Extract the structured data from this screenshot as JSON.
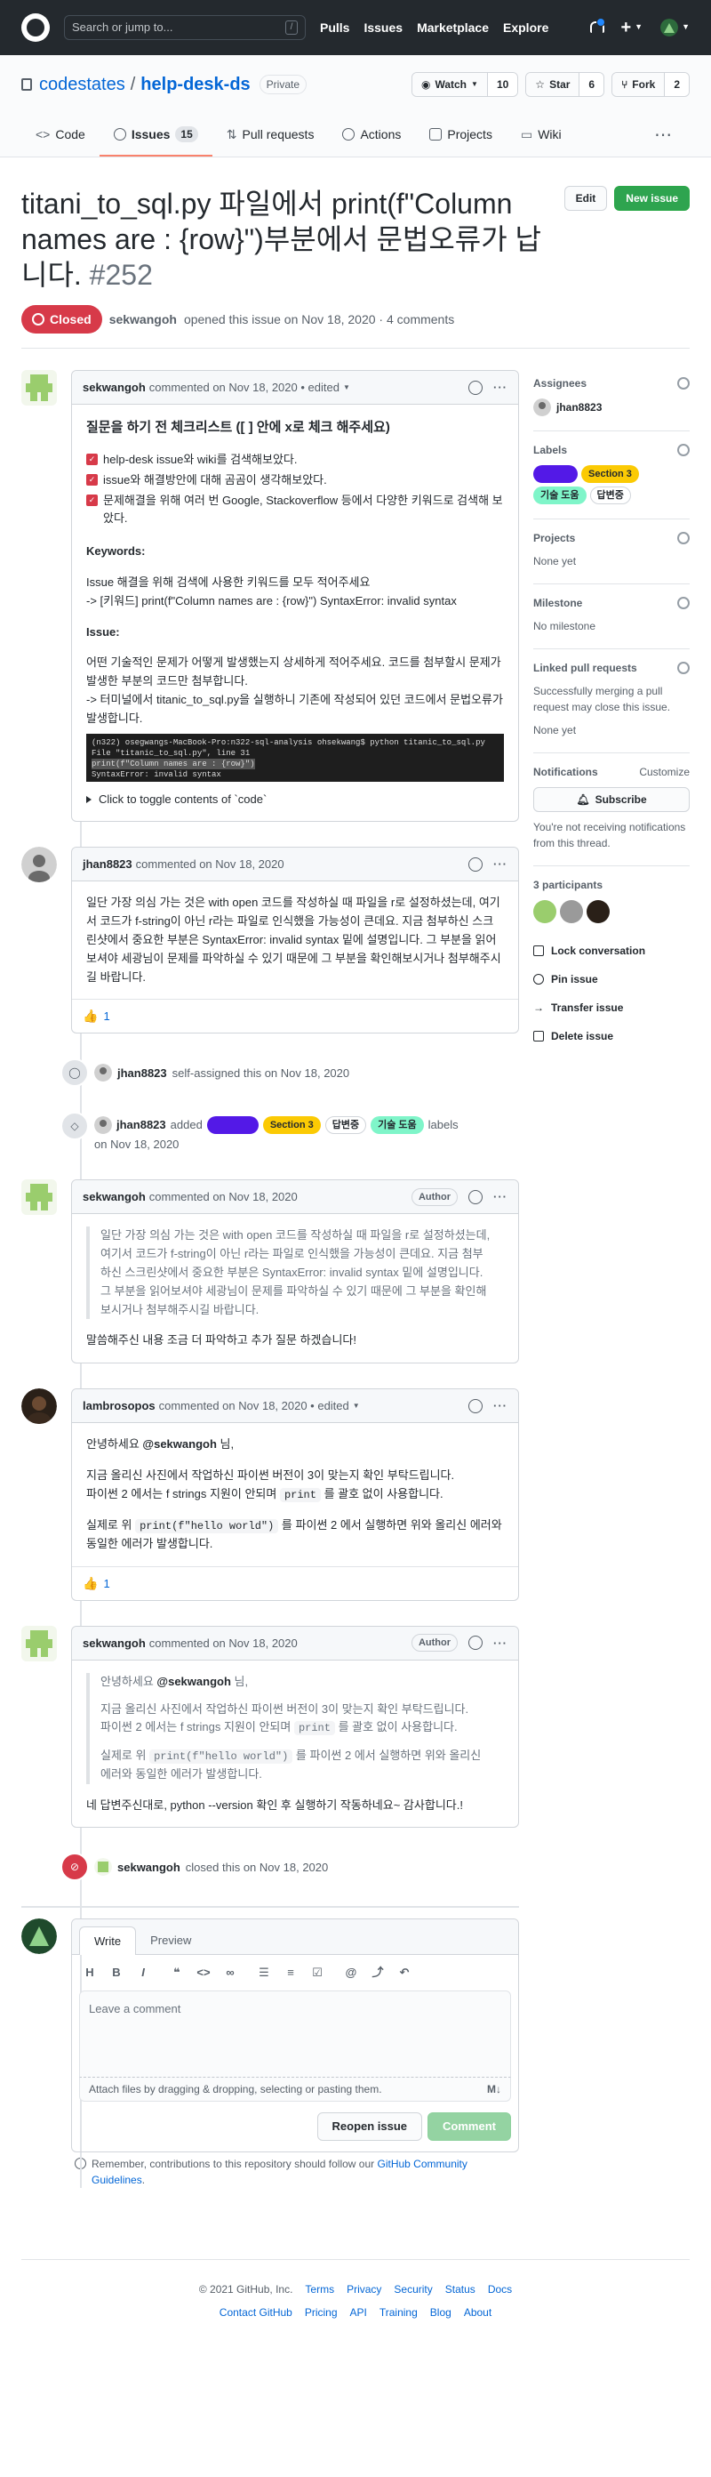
{
  "header": {
    "search_placeholder": "Search or jump to...",
    "search_key": "/",
    "nav": [
      "Pulls",
      "Issues",
      "Marketplace",
      "Explore"
    ]
  },
  "repo": {
    "owner": "codestates",
    "sep": "/",
    "name": "help-desk-ds",
    "visibility": "Private",
    "watch_label": "Watch",
    "watch_count": "10",
    "star_label": "Star",
    "star_count": "6",
    "fork_label": "Fork",
    "fork_count": "2"
  },
  "tabs": [
    {
      "label": "Code"
    },
    {
      "label": "Issues",
      "count": "15"
    },
    {
      "label": "Pull requests"
    },
    {
      "label": "Actions"
    },
    {
      "label": "Projects"
    },
    {
      "label": "Wiki"
    }
  ],
  "issue": {
    "title": "titani_to_sql.py 파일에서 print(f\"Column names are : {row}\")부분에서 문법오류가 납니다.",
    "number": "#252",
    "edit_label": "Edit",
    "new_label": "New issue",
    "state": "Closed",
    "author": "sekwangoh",
    "meta": "opened this issue on Nov 18, 2020 · 4 comments"
  },
  "labels": {
    "l1": {
      "text": "",
      "color": "#5319e7"
    },
    "l2": {
      "text": "Section 3",
      "color": "#fbca04"
    },
    "l3": {
      "text": "기술 도움",
      "color": "#7ff5c9"
    },
    "l4": {
      "text": "답변중",
      "color": "#ffffff"
    }
  },
  "comments": {
    "c1": {
      "author": "sekwangoh",
      "meta": "commented on Nov 18, 2020 • edited",
      "heading": "질문을 하기 전 체크리스트 ([ ] 안에 x로 체크 해주세요)",
      "checks": [
        "help-desk issue와 wiki를 검색해보았다.",
        "issue와 해결방안에 대해 곰곰이 생각해보았다.",
        "문제해결을 위해 여러 번 Google, Stackoverflow 등에서 다양한 키워드로 검색해 보았다."
      ],
      "kw_title": "Keywords:",
      "kw_text": "Issue 해결을 위해 검색에 사용한 키워드를 모두 적어주세요",
      "kw_value": "-> [키워드] print(f\"Column names are : {row}\") SyntaxError: invalid syntax",
      "issue_title": "Issue:",
      "issue_text": "어떤 기술적인 문제가 어떻게 발생했는지 상세하게 적어주세요. 코드를 첨부할시 문제가 발생한 부분의 코드만 첨부합니다.",
      "issue_text2": "-> 터미널에서 titanic_to_sql.py을 실행하니 기존에 작성되어 있던 코드에서 문법오류가 발생합니다.",
      "term1": "(n322) osegwangs-MacBook-Pro:n322-sql-analysis ohsekwang$ python titanic_to_sql.py",
      "term2": "  File \"titanic_to_sql.py\", line 31",
      "term3": "    print(f\"Column names are : {row}\")",
      "term4": "SyntaxError: invalid syntax",
      "details": "Click to toggle contents of `code`"
    },
    "c2": {
      "author": "jhan8823",
      "meta": "commented on Nov 18, 2020",
      "body": "일단 가장 의심 가는 것은 with open 코드를 작성하실 때 파일을 r로 설정하셨는데, 여기서 코드가 f-string이 아닌 r라는 파일로 인식했을 가능성이 큰데요. 지금 첨부하신 스크린샷에서 중요한 부분은 SyntaxError: invalid syntax 밑에 설명입니다. 그 부분을 읽어보셔야 세광님이 문제를 파악하실 수 있기 때문에 그 부분을 확인해보시거나 첨부해주시길 바랍니다.",
      "reaction": "👍",
      "reaction_count": "1"
    },
    "c3": {
      "author": "sekwangoh",
      "meta": "commented on Nov 18, 2020",
      "badge": "Author",
      "quote": "일단 가장 의심 가는 것은 with open 코드를 작성하실 때 파일을 r로 설정하셨는데, 여기서 코드가 f-string이 아닌 r라는 파일로 인식했을 가능성이 큰데요. 지금 첨부하신 스크린샷에서 중요한 부분은 SyntaxError: invalid syntax 밑에 설명입니다. 그 부분을 읽어보셔야 세광님이 문제를 파악하실 수 있기 때문에 그 부분을 확인해보시거나 첨부해주시길 바랍니다.",
      "body": "말씀해주신 내용 조금 더 파악하고 추가 질문 하겠습니다!"
    },
    "c4": {
      "author": "lambrosopos",
      "meta": "commented on Nov 18, 2020 • edited",
      "p1a": "안녕하세요 ",
      "mention": "@sekwangoh",
      "p1b": " 님,",
      "p2": "지금 올리신 사진에서 작업하신 파이썬 버전이 3이 맞는지 확인 부탁드립니다.",
      "p3a": "파이썬 2 에서는 f strings 지원이 안되며 ",
      "p3code": "print",
      "p3b": " 를 괄호 없이 사용합니다.",
      "p4a": "실제로 위 ",
      "p4code": "print(f\"hello world\")",
      "p4b": " 를 파이썬 2 에서 실행하면 위와 올리신 에러와 동일한 에러가 발생합니다.",
      "reaction": "👍",
      "reaction_count": "1"
    },
    "c5": {
      "author": "sekwangoh",
      "meta": "commented on Nov 18, 2020",
      "badge": "Author",
      "body": "네 답변주신대로, python --version 확인 후 실행하기 작동하네요~ 감사합니다.!"
    }
  },
  "events": {
    "assign": {
      "user": "jhan8823",
      "text": "self-assigned this on Nov 18, 2020"
    },
    "label": {
      "user": "jhan8823",
      "added": "added",
      "labels_word": "labels",
      "date": "on Nov 18, 2020"
    },
    "closed": {
      "user": "sekwangoh",
      "text": "closed this on Nov 18, 2020"
    }
  },
  "sidebar": {
    "assignees_title": "Assignees",
    "assignee": "jhan8823",
    "labels_title": "Labels",
    "projects_title": "Projects",
    "projects_value": "None yet",
    "milestone_title": "Milestone",
    "milestone_value": "No milestone",
    "linked_title": "Linked pull requests",
    "linked_text": "Successfully merging a pull request may close this issue.",
    "linked_value": "None yet",
    "notif_title": "Notifications",
    "notif_customize": "Customize",
    "subscribe": "Subscribe",
    "notif_text": "You're not receiving notifications from this thread.",
    "participants": "3 participants",
    "lock": "Lock conversation",
    "pin": "Pin issue",
    "transfer": "Transfer issue",
    "delete": "Delete issue"
  },
  "composer": {
    "tab_write": "Write",
    "tab_preview": "Preview",
    "placeholder": "Leave a comment",
    "attach": "Attach files by dragging & dropping, selecting or pasting them.",
    "reopen": "Reopen issue",
    "comment": "Comment",
    "tip_text": "Remember, contributions to this repository should follow our ",
    "tip_link": "GitHub Community Guidelines",
    "tip_end": "."
  },
  "footer": {
    "copyright": "© 2021 GitHub, Inc.",
    "row1": [
      "Terms",
      "Privacy",
      "Security",
      "Status",
      "Docs"
    ],
    "row2": [
      "Contact GitHub",
      "Pricing",
      "API",
      "Training",
      "Blog",
      "About"
    ]
  }
}
